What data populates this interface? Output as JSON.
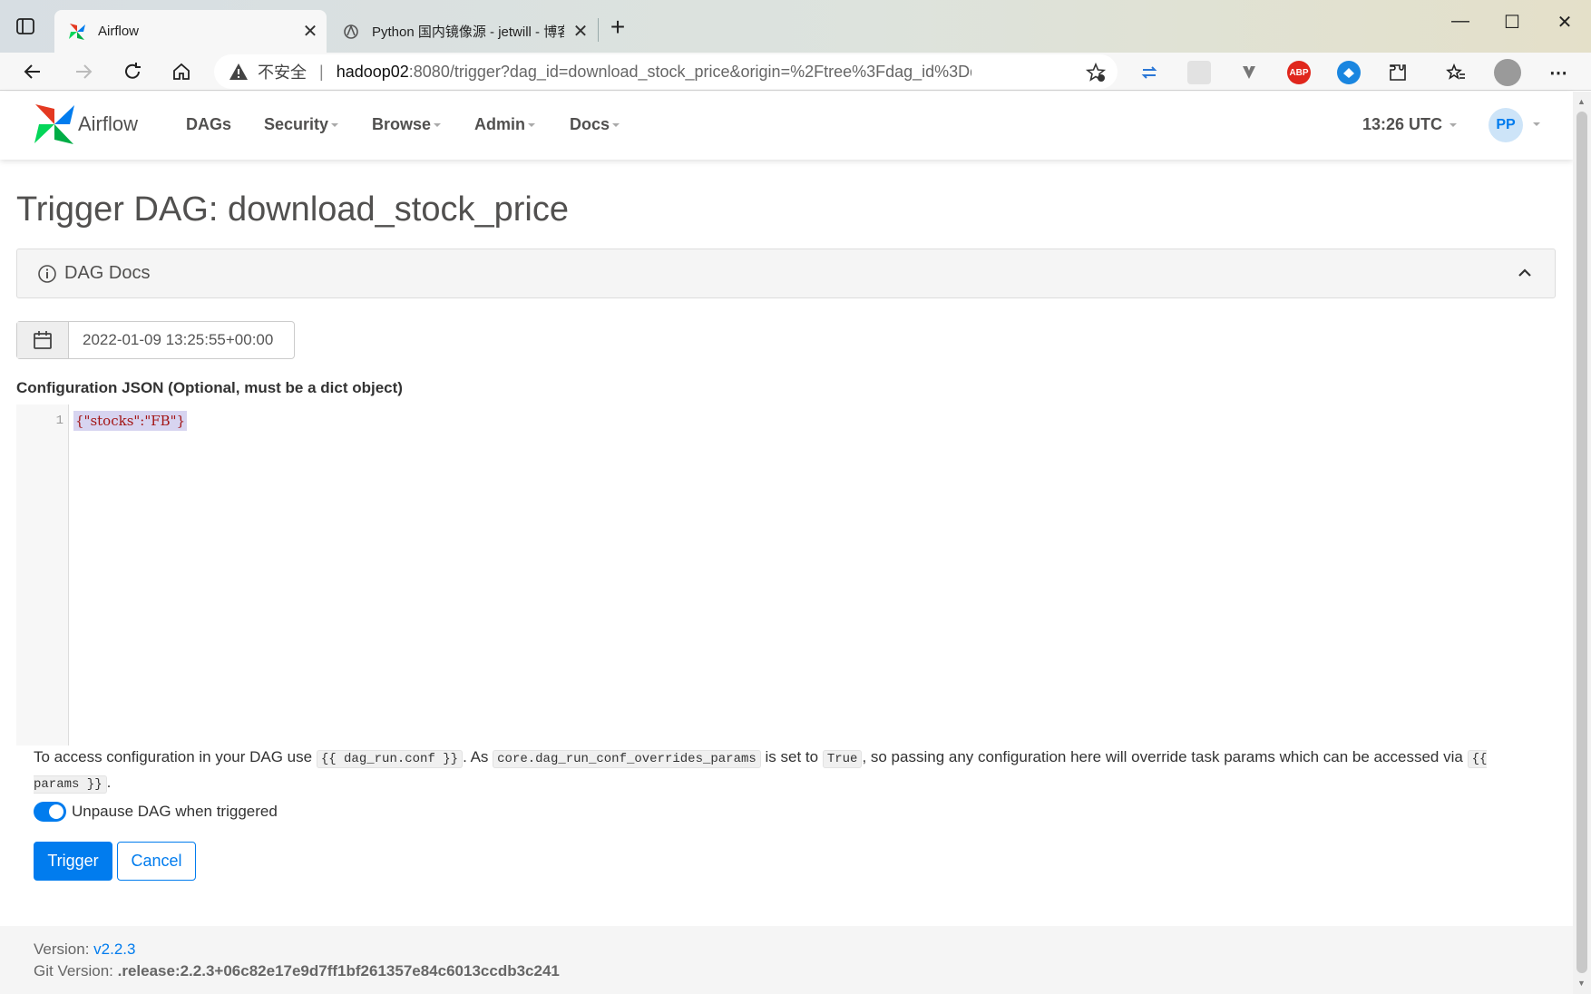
{
  "browser": {
    "tabs": [
      {
        "title": "Airflow",
        "active": true,
        "icon": "airflow-pinwheel-icon"
      },
      {
        "title": "Python 国内镜像源 - jetwill - 博客",
        "active": false,
        "icon": "cnblogs-icon"
      }
    ],
    "address": {
      "insecure_label": "不安全",
      "host": "hadoop02",
      "path": ":8080/trigger?dag_id=download_stock_price&origin=%2Ftree%3Fdag_id%3Ddownload_stock..."
    }
  },
  "navbar": {
    "brand": "Airflow",
    "menu": [
      "DAGs",
      "Security",
      "Browse",
      "Admin",
      "Docs"
    ],
    "time": "13:26 UTC",
    "user_initials": "PP"
  },
  "page": {
    "title": "Trigger DAG: download_stock_price",
    "docs_label": "DAG Docs",
    "execution_date": "2022-01-09 13:25:55+00:00",
    "conf_label": "Configuration JSON (Optional, must be a dict object)",
    "editor": {
      "line_number": "1",
      "content": "{\"stocks\":\"FB\"}"
    },
    "help": {
      "p1": "To access configuration in your DAG use ",
      "code1": "{{ dag_run.conf }}",
      "p2": ". As ",
      "code2": "core.dag_run_conf_overrides_params",
      "p3": " is set to ",
      "code3": "True",
      "p4": ", so passing any configuration here will override task params which can be accessed via ",
      "code4": "{{ params }}",
      "p5": "."
    },
    "unpause_label": "Unpause DAG when triggered",
    "unpause_on": true,
    "trigger_label": "Trigger",
    "cancel_label": "Cancel"
  },
  "footer": {
    "version_label": "Version: ",
    "version": "v2.2.3",
    "git_label": "Git Version: ",
    "git_version": ".release:2.2.3+06c82e17e9d7ff1bf261357e84c6013ccdb3c241"
  },
  "colors": {
    "accent": "#017cee",
    "text": "#51504f"
  }
}
